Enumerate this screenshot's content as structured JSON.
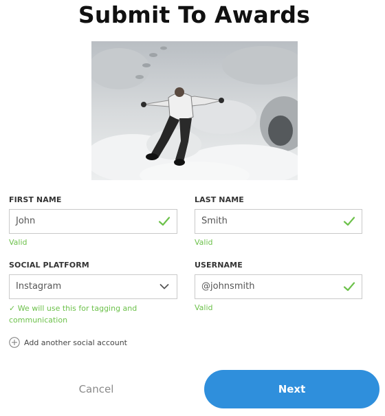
{
  "page": {
    "title": "Submit To Awards"
  },
  "photo": {
    "description_icon": "snow-angel-photo"
  },
  "form": {
    "first_name": {
      "label": "FIRST NAME",
      "value": "John",
      "status": "Valid"
    },
    "last_name": {
      "label": "LAST NAME",
      "value": "Smith",
      "status": "Valid"
    },
    "social_platform": {
      "label": "SOCIAL PLATFORM",
      "value": "Instagram",
      "hint": "✓ We will use this for tagging and communication"
    },
    "username": {
      "label": "USERNAME",
      "value": "@johnsmith",
      "status": "Valid"
    },
    "add_social_label": "Add another social account"
  },
  "actions": {
    "cancel_label": "Cancel",
    "next_label": "Next"
  },
  "colors": {
    "valid": "#6cc14a",
    "primary_button": "#2f8fdc"
  }
}
